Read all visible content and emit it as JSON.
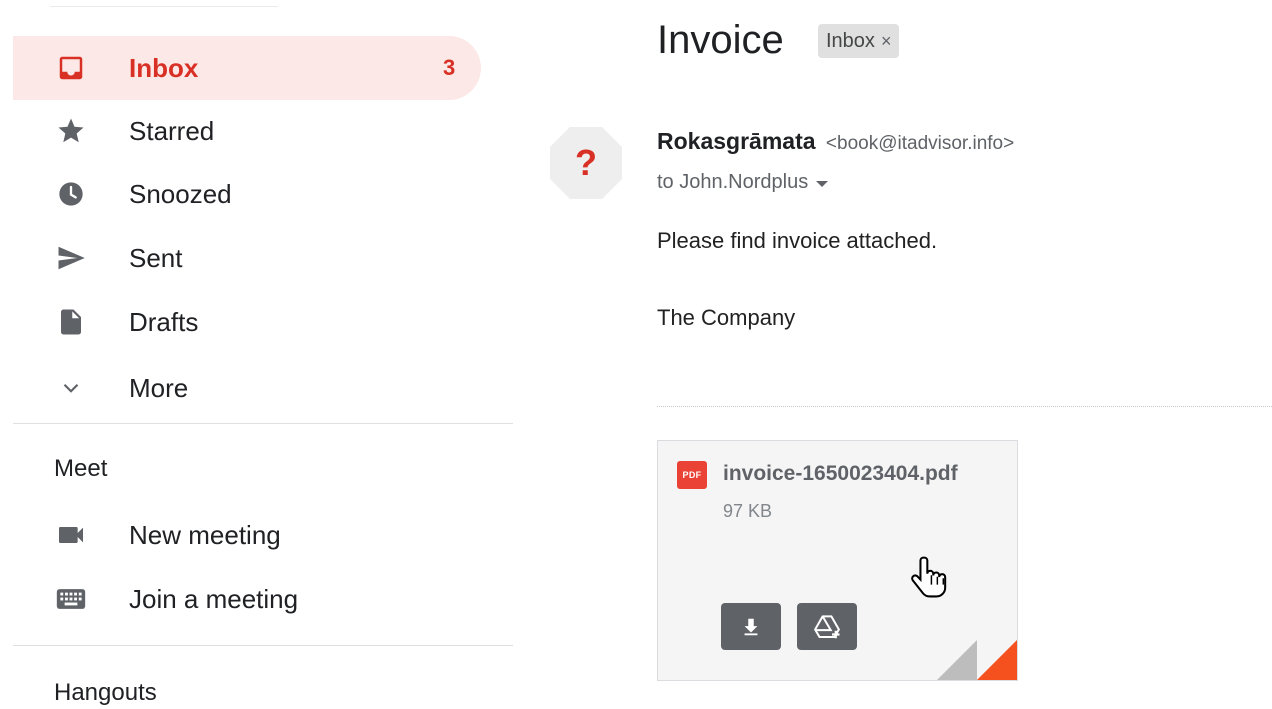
{
  "sidebar": {
    "items": [
      {
        "label": "Inbox",
        "count": "3",
        "icon": "inbox-icon"
      },
      {
        "label": "Starred",
        "icon": "star-icon"
      },
      {
        "label": "Snoozed",
        "icon": "clock-icon"
      },
      {
        "label": "Sent",
        "icon": "send-icon"
      },
      {
        "label": "Drafts",
        "icon": "draft-icon"
      },
      {
        "label": "More",
        "icon": "chevron-down-icon"
      }
    ],
    "meet": {
      "title": "Meet",
      "items": [
        {
          "label": "New meeting",
          "icon": "video-camera-icon"
        },
        {
          "label": "Join a meeting",
          "icon": "keyboard-icon"
        }
      ]
    },
    "hangouts": {
      "title": "Hangouts"
    }
  },
  "email": {
    "subject": "Invoice",
    "label_chip": "Inbox",
    "label_chip_close": "×",
    "avatar_glyph": "?",
    "sender_name": "Rokasgrāmata",
    "sender_email": "<book@itadvisor.info>",
    "recipient": "to John.Nordplus",
    "body": [
      "Please find invoice attached.",
      "The Company"
    ],
    "attachment": {
      "type_badge": "PDF",
      "filename": "invoice-1650023404.pdf",
      "size": "97 KB"
    }
  },
  "colors": {
    "accent": "#d93025",
    "active_bg": "#fce8e6",
    "pdf_red": "#ea4335",
    "button_gray": "#5f6368"
  }
}
